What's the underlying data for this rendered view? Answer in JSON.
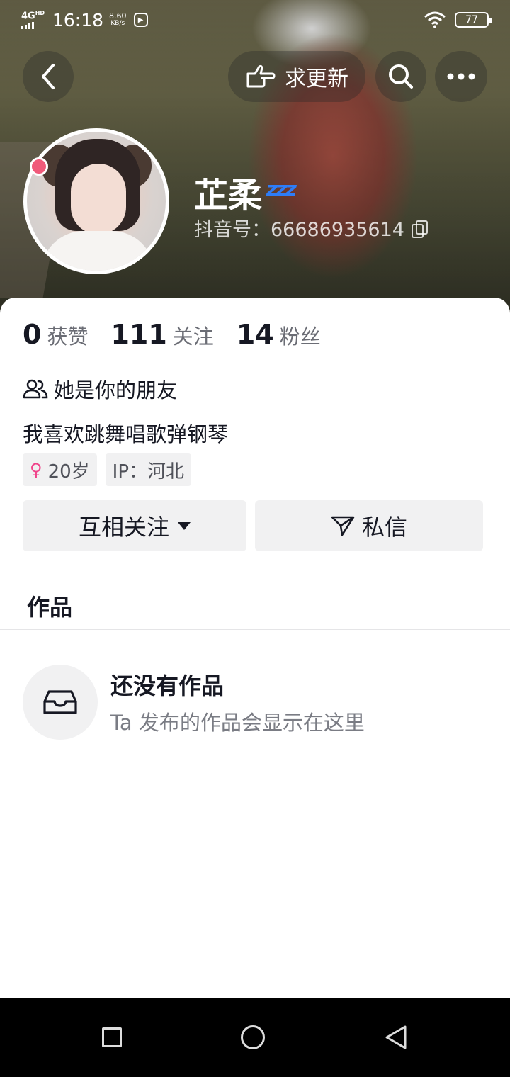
{
  "status_bar": {
    "network": "4G",
    "network_sup": "HD",
    "time": "16:18",
    "speed_value": "8.60",
    "speed_unit": "KB/s",
    "battery": "77"
  },
  "header": {
    "update_label": "求更新"
  },
  "profile": {
    "name": "芷柔",
    "name_emoji": "zzz",
    "douyin_id": "抖音号：66686935614"
  },
  "stats": [
    {
      "value": "0",
      "label": "获赞"
    },
    {
      "value": "111",
      "label": "关注"
    },
    {
      "value": "14",
      "label": "粉丝"
    }
  ],
  "friend_text": "她是你的朋友",
  "bio": "我喜欢跳舞唱歌弹钢琴",
  "tags": {
    "age": "20岁",
    "ip": "IP：河北"
  },
  "actions": {
    "follow_label": "互相关注",
    "message_label": "私信"
  },
  "tabs": {
    "works_label": "作品"
  },
  "empty_state": {
    "title": "还没有作品",
    "subtitle": "Ta 发布的作品会显示在这里"
  }
}
